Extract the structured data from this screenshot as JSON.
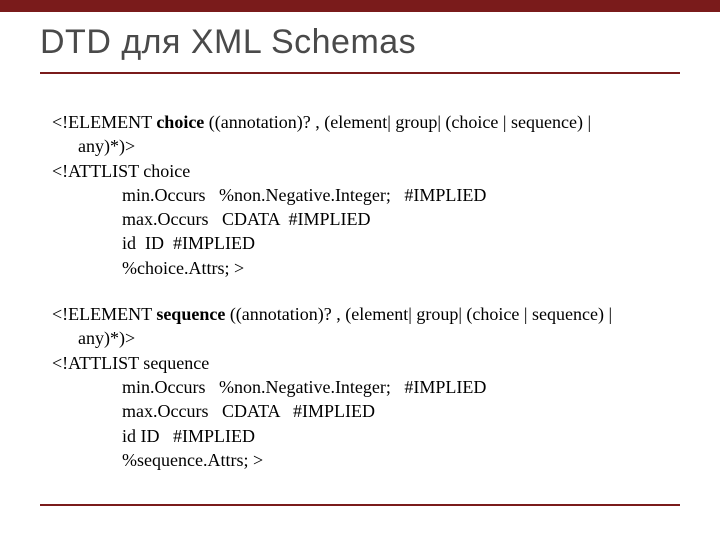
{
  "title": "DTD для XML Schemas",
  "blocks": [
    {
      "element": {
        "prefix": "<!ELEMENT ",
        "name": "choice",
        "rest": " ((annotation)? , (element| group| (choice | sequence) |",
        "cont": "any)*)>"
      },
      "attlist_head": "<!ATTLIST choice",
      "attrs": [
        "min.Occurs   %non.Negative.Integer;   #IMPLIED",
        "max.Occurs   CDATA  #IMPLIED",
        "id  ID  #IMPLIED",
        "%choice.Attrs; >"
      ]
    },
    {
      "element": {
        "prefix": "<!ELEMENT ",
        "name": "sequence",
        "rest": " ((annotation)? , (element| group| (choice | sequence) |",
        "cont": "any)*)>"
      },
      "attlist_head": "<!ATTLIST sequence",
      "attrs": [
        "min.Occurs   %non.Negative.Integer;   #IMPLIED",
        "max.Occurs   CDATA   #IMPLIED",
        "id ID   #IMPLIED",
        "%sequence.Attrs; >"
      ]
    }
  ]
}
